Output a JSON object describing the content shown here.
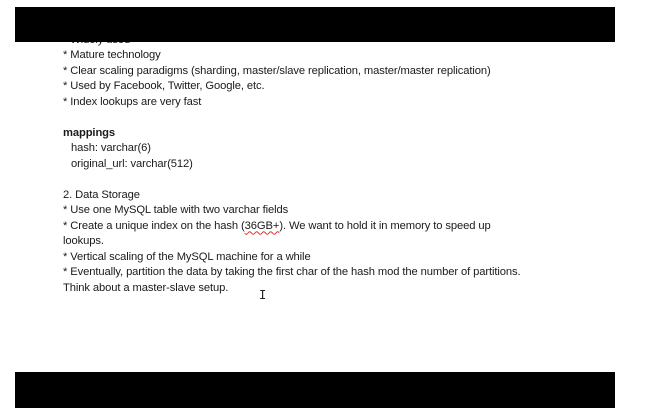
{
  "doc": {
    "cut_line": "* Widely used",
    "bullets_a": [
      "* Mature technology",
      "* Clear scaling paradigms (sharding, master/slave replication, master/master replication)",
      "* Used by Facebook, Twitter, Google, etc.",
      "* Index lookups are very fast"
    ],
    "mappings": {
      "heading": "mappings",
      "fields": [
        "hash: varchar(6)",
        "original_url: varchar(512)"
      ]
    },
    "section_title": "2. Data Storage",
    "bullet_table": "* Use one MySQL table with two varchar fields",
    "bullet_index": {
      "before": "* Create a unique index on the hash (",
      "flagged": "36GB+",
      "after": "). We want to hold it in memory to speed up",
      "wrap": "lookups."
    },
    "bullet_vertical": "* Vertical scaling of the MySQL machine for a while",
    "bullet_partition": "* Eventually, partition the data by taking the first char of the hash mod the number of partitions.",
    "closing": "Think about a master-slave setup."
  },
  "cursor_glyph": "I",
  "colors": {
    "letterbox": "#000000",
    "page": "#ffffff",
    "text": "#1a1a1a",
    "spellcheck": "#dd3333"
  },
  "icons": {
    "cursor": "text-cursor-icon"
  }
}
